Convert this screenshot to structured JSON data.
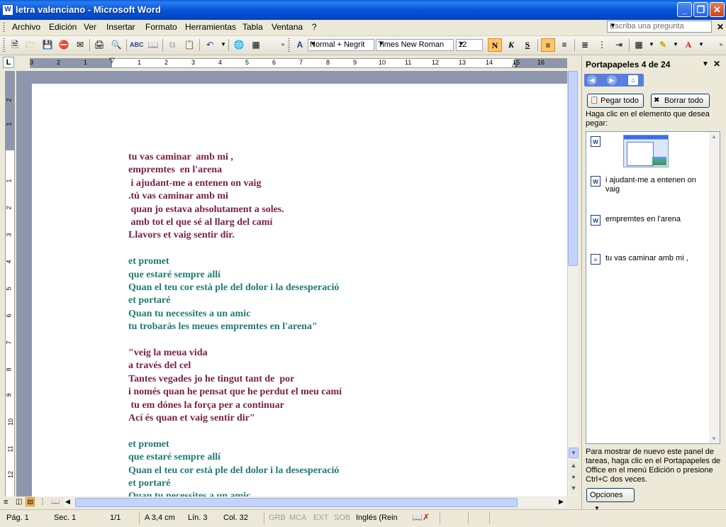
{
  "window": {
    "title": "letra valenciano - Microsoft Word",
    "app_icon": "W",
    "controls": {
      "minimize_icon": "minimize-icon",
      "maximize_icon": "restore-icon",
      "close_icon": "close-icon"
    }
  },
  "menubar": {
    "items": [
      "Archivo",
      "Edición",
      "Ver",
      "Insertar",
      "Formato",
      "Herramientas",
      "Tabla",
      "Ventana",
      "?"
    ],
    "ask_placeholder": "Escriba una pregunta"
  },
  "toolbar": {
    "style": "Normal + Negrit",
    "font": "Times New Roman",
    "size": "12",
    "bold": "N",
    "italic": "K",
    "underline": "S"
  },
  "ruler": {
    "h_labels": [
      "3",
      "2",
      "1",
      "1",
      "2",
      "3",
      "4",
      "5",
      "6",
      "7",
      "8",
      "9",
      "10",
      "11",
      "12",
      "13",
      "14",
      "15",
      "16"
    ],
    "v_labels": [
      "2",
      "1",
      "1",
      "2",
      "3",
      "4",
      "5",
      "6",
      "7",
      "8",
      "9",
      "10",
      "11",
      "12"
    ]
  },
  "document": {
    "lines": [
      {
        "text": "tu vas caminar  amb mi ,",
        "color": "#7a1e45"
      },
      {
        "text": "empremtes  en l'arena",
        "color": "#7a1e45"
      },
      {
        "text": " i ajudant-me a entenen on vaig",
        "color": "#7a1e45"
      },
      {
        "text": ".tú vas caminar amb mi",
        "color": "#7a1e45"
      },
      {
        "text": " quan jo estava absolutament a soles.",
        "color": "#7a1e45"
      },
      {
        "text": " amb tot el que sé al llarg del camí",
        "color": "#7a1e45"
      },
      {
        "text": "Llavors et vaig sentir dir.",
        "color": "#7a1e45"
      },
      {
        "text": "",
        "color": "#7a1e45"
      },
      {
        "text": "et promet",
        "color": "#1f7a75"
      },
      {
        "text": "que estaré sempre allí",
        "color": "#1f7a75"
      },
      {
        "text": "Quan el teu cor està ple del dolor i la desesperació",
        "color": "#1f7a75"
      },
      {
        "text": "et portaré",
        "color": "#1f7a75"
      },
      {
        "text": "Quan tu necessites a un amic",
        "color": "#1f7a75"
      },
      {
        "text": "tu trobaràs les meues empremtes en l'arena\"",
        "color": "#1f7a75"
      },
      {
        "text": "",
        "color": "#1f7a75"
      },
      {
        "text": "\"veig la meua vida",
        "color": "#7a1e45"
      },
      {
        "text": "a través del cel",
        "color": "#7a1e45"
      },
      {
        "text": "Tantes vegades jo he tingut tant de  por",
        "color": "#7a1e45"
      },
      {
        "text": "i només quan he pensat que he perdut el meu camí",
        "color": "#7a1e45"
      },
      {
        "text": " tu em dónes la força per a continuar",
        "color": "#7a1e45"
      },
      {
        "text": "Ací és quan et vaig sentir dir\"",
        "color": "#7a1e45"
      },
      {
        "text": "",
        "color": "#7a1e45"
      },
      {
        "text": "et promet",
        "color": "#1f7a75"
      },
      {
        "text": "que estaré sempre allí",
        "color": "#1f7a75"
      },
      {
        "text": "Quan el teu cor està ple del dolor i la desesperació",
        "color": "#1f7a75"
      },
      {
        "text": "et portaré",
        "color": "#1f7a75"
      },
      {
        "text": "Quan tu necessites a un amic",
        "color": "#1f7a75"
      }
    ]
  },
  "taskpane": {
    "title": "Portapapeles 4 de 24",
    "paste_all": "Pegar todo",
    "clear_all": "Borrar todo",
    "instruction": "Haga clic en el elemento que desea pegar:",
    "clips": [
      {
        "type": "image",
        "text": ""
      },
      {
        "type": "text",
        "text": "i ajudant-me a entenen on vaig"
      },
      {
        "type": "text",
        "text": "empremtes en l'arena"
      },
      {
        "type": "text",
        "text": "tu vas caminar amb mi ,"
      }
    ],
    "note": "Para mostrar de nuevo este panel de tareas, haga clic en el Portapapeles de Office en el menú Edición o presione Ctrl+C dos veces.",
    "options": "Opciones"
  },
  "statusbar": {
    "page": "Pág. 1",
    "section": "Sec. 1",
    "pages": "1/1",
    "at": "A 3,4 cm",
    "line": "Lín. 3",
    "col": "Col. 32",
    "grb": "GRB",
    "mca": "MCA",
    "ext": "EXT",
    "sob": "SOB",
    "lang": "Inglés (Rein"
  }
}
